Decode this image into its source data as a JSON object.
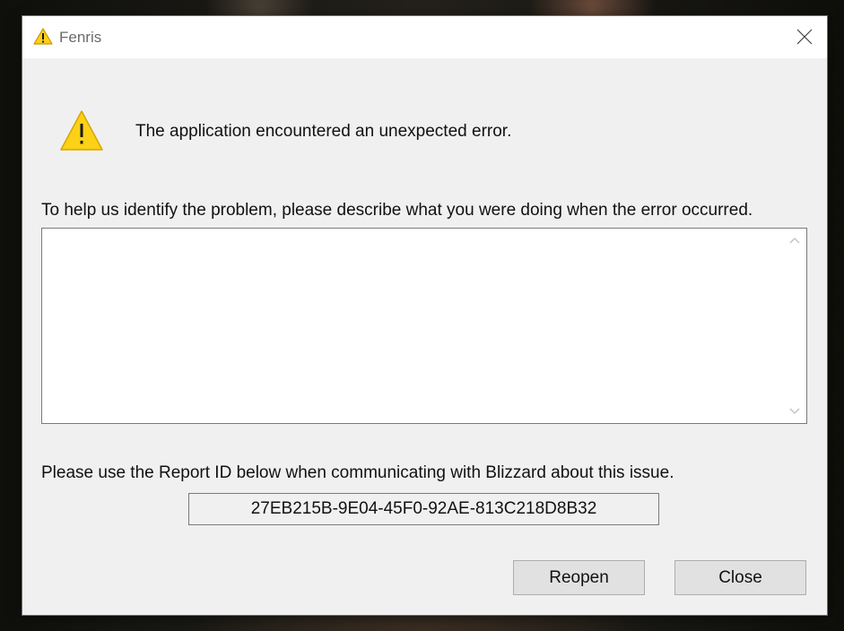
{
  "window": {
    "title": "Fenris",
    "title_icon": "warning-triangle-icon",
    "close_icon": "close-x-icon"
  },
  "message": {
    "icon": "warning-triangle-icon",
    "text": "The application encountered an unexpected error."
  },
  "description": {
    "label": "To help us identify the problem, please describe what you were doing when the error occurred.",
    "value": "",
    "scroll_up_icon": "chevron-up-icon",
    "scroll_down_icon": "chevron-down-icon"
  },
  "report": {
    "label": "Please use the Report ID below when communicating with Blizzard about this issue.",
    "id": "27EB215B-9E04-45F0-92AE-813C218D8B32"
  },
  "buttons": {
    "reopen": "Reopen",
    "close": "Close"
  },
  "colors": {
    "warning_fill": "#fcd116",
    "warning_stroke": "#c99700",
    "dialog_bg": "#f0f0f0",
    "button_bg": "#e1e1e1"
  }
}
